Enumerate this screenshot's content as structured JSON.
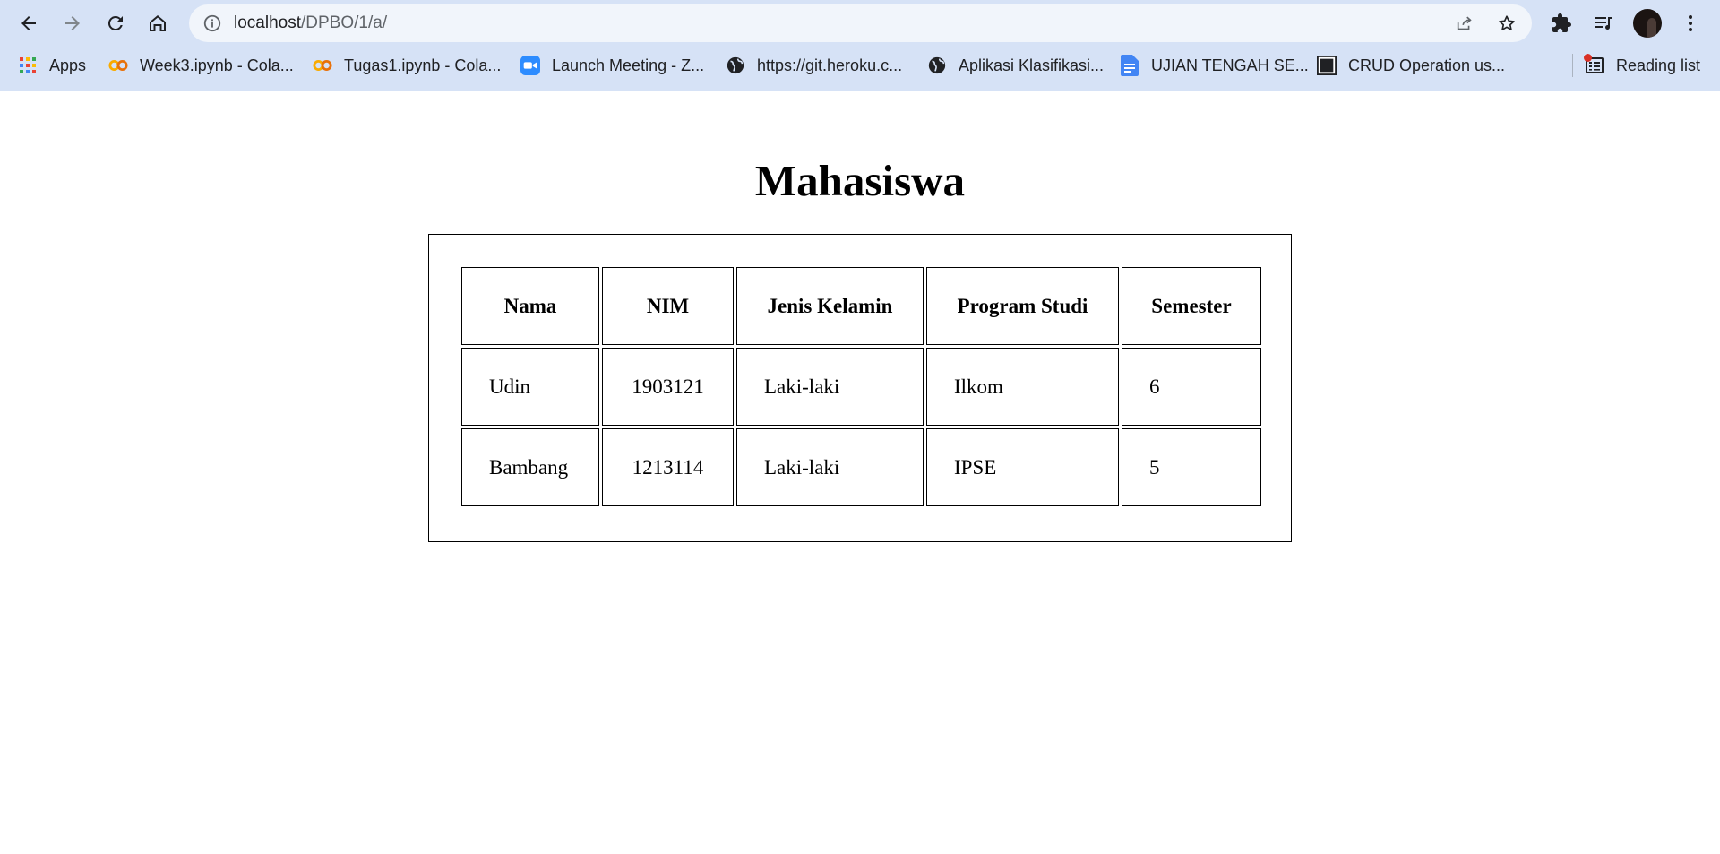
{
  "browser": {
    "url_host": "localhost",
    "url_path": "/DPBO/1/a/",
    "icons": {
      "back": "back-arrow-icon",
      "forward": "forward-arrow-icon",
      "reload": "reload-icon",
      "home": "home-icon",
      "site_info": "info-icon",
      "share": "share-icon",
      "bookmark": "star-icon",
      "extensions": "puzzle-icon",
      "media": "media-queue-icon",
      "menu": "kebab-menu-icon"
    }
  },
  "bookmarks": [
    {
      "label": "Apps",
      "icon": "apps-grid-icon"
    },
    {
      "label": "Week3.ipynb - Cola...",
      "icon": "colab-icon"
    },
    {
      "label": "Tugas1.ipynb - Cola...",
      "icon": "colab-icon"
    },
    {
      "label": "Launch Meeting - Z...",
      "icon": "zoom-icon"
    },
    {
      "label": "https://git.heroku.c...",
      "icon": "globe-icon"
    },
    {
      "label": "Aplikasi Klasifikasi...",
      "icon": "globe-icon"
    },
    {
      "label": "UJIAN TENGAH SE...",
      "icon": "google-docs-icon"
    },
    {
      "label": "CRUD Operation us...",
      "icon": "site-logo-icon"
    }
  ],
  "reading_list": {
    "label": "Reading list",
    "icon": "reading-list-icon"
  },
  "page": {
    "title": "Mahasiswa",
    "table": {
      "headers": [
        "Nama",
        "NIM",
        "Jenis Kelamin",
        "Program Studi",
        "Semester"
      ],
      "rows": [
        [
          "Udin",
          "1903121",
          "Laki-laki",
          "Ilkom",
          "6"
        ],
        [
          "Bambang",
          "1213114",
          "Laki-laki",
          "IPSE",
          "5"
        ]
      ]
    }
  }
}
